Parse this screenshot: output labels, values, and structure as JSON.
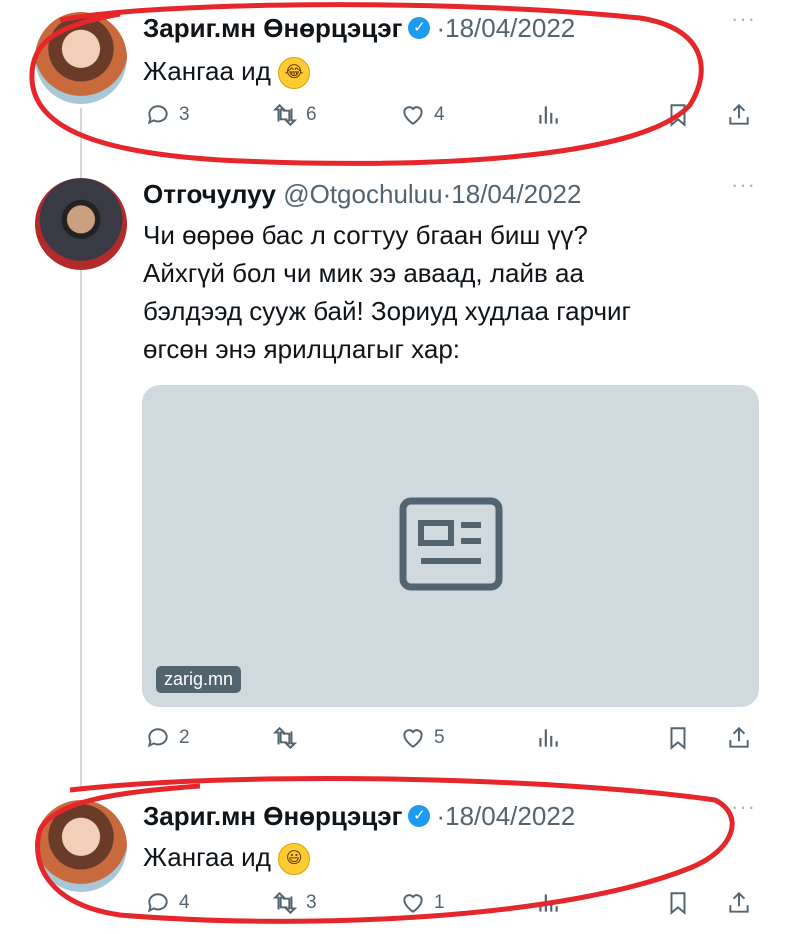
{
  "tweets": [
    {
      "name": "Зариг.мн Өнөрцэцэг",
      "verified": true,
      "handle": "",
      "date": "18/04/2022",
      "text_lines": [
        "Жангаа ид"
      ],
      "emoji": "laughing-emoji",
      "replies": "3",
      "retweets": "6",
      "likes": "4"
    },
    {
      "name": "Отгочулуу",
      "verified": false,
      "handle": "@Otgochuluu",
      "date": "18/04/2022",
      "text_lines": [
        "Чи өөрөө бас л согтуу бгаан биш үү?",
        "Айхгүй бол чи мик ээ аваад, лайв аа",
        "бэлдээд сууж бай! Зориуд худлаа гарчиг",
        "өгсөн энэ ярилцлагыг хар:"
      ],
      "card_domain": "zarig.mn",
      "replies": "2",
      "retweets": "",
      "likes": "5"
    },
    {
      "name": "Зариг.мн Өнөрцэцэг",
      "verified": true,
      "handle": "",
      "date": "18/04/2022",
      "text_lines": [
        "Жангаа ид"
      ],
      "emoji": "smiling-emoji",
      "replies": "4",
      "retweets": "3",
      "likes": "1"
    }
  ],
  "separator": "·",
  "more_label": "···",
  "verified_mark": "✓",
  "colors": {
    "accent": "#1d9bf0",
    "muted": "#536471",
    "annotation": "#e5262b"
  }
}
